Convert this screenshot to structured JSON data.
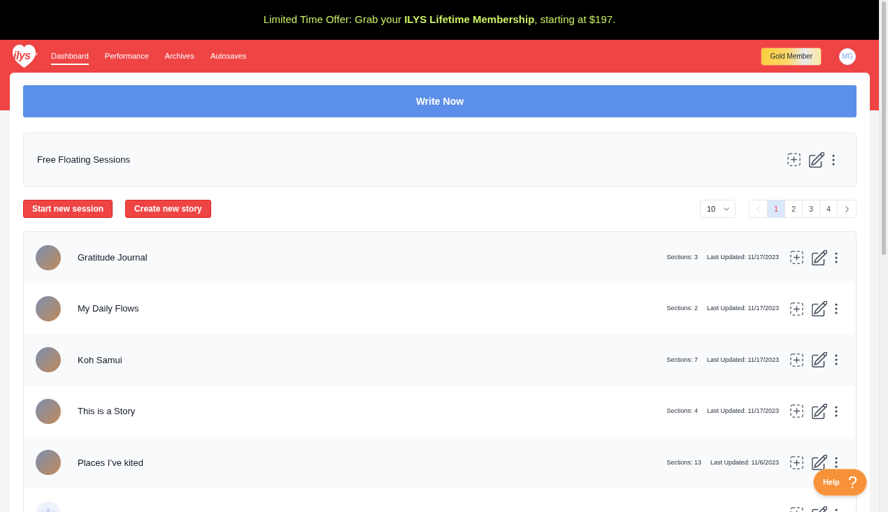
{
  "banner": {
    "text": "Limited Time Offer: Grab your **ILYS Lifetime Membership**, starting at $197."
  },
  "header": {
    "logo": "ilys",
    "logo_mark": "®",
    "nav": [
      {
        "label": "Dashboard",
        "selected": true
      },
      {
        "label": "Performance",
        "selected": false
      },
      {
        "label": "Archives",
        "selected": false
      },
      {
        "label": "Autosaves",
        "selected": false
      }
    ],
    "membership_button": "Gold Member",
    "avatar_initials": "MG"
  },
  "write_button": "Write Now",
  "free_floating": {
    "title": "Free Floating Sessions"
  },
  "actions": [
    "Start new session",
    "Create new story"
  ],
  "page_size": {
    "value": "10"
  },
  "pagination": {
    "previous": {
      "disabled": true
    },
    "pages": [
      {
        "label": "1",
        "selected": true
      },
      {
        "label": "2",
        "selected": false
      },
      {
        "label": "3",
        "selected": false
      },
      {
        "label": "4",
        "selected": false
      }
    ],
    "next": {
      "disabled": false
    }
  },
  "stories": [
    {
      "kind": "photo",
      "title": "Gratitude Journal",
      "sections": "Sections: 3",
      "updated": "Last Updated: 11/17/2023"
    },
    {
      "kind": "photo",
      "title": "My Daily Flows",
      "sections": "Sections: 2",
      "updated": "Last Updated: 11/17/2023"
    },
    {
      "kind": "photo",
      "title": "Koh Samui",
      "sections": "Sections: 7",
      "updated": "Last Updated: 11/17/2023"
    },
    {
      "kind": "photo",
      "title": "This is a Story",
      "sections": "Sections: 4",
      "updated": "Last Updated: 11/17/2023"
    },
    {
      "kind": "photo",
      "title": "Places I’ve kited",
      "sections": "Sections: 13",
      "updated": "Last Updated: 11/6/2023"
    },
    {
      "kind": "lotus"
    }
  ],
  "help": {
    "label": "Help",
    "icon": "?"
  }
}
